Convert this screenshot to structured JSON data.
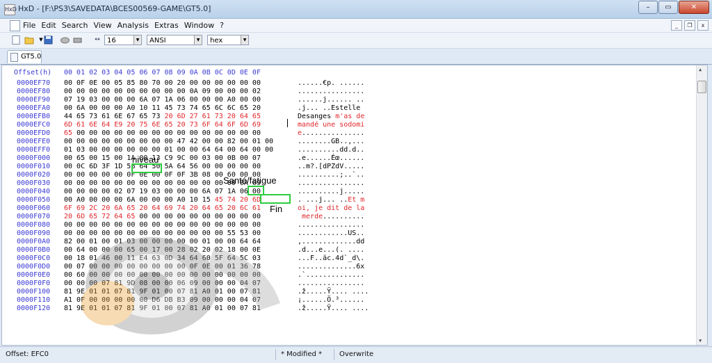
{
  "window": {
    "title": "HxD - [F:\\PS3\\SAVEDATA\\BCES00569-GAME\\GT5.0]",
    "app_icon": "HxD"
  },
  "window_buttons": [
    "–",
    "▭",
    "✕"
  ],
  "menu": [
    "File",
    "Edit",
    "Search",
    "View",
    "Analysis",
    "Extras",
    "Window",
    "?"
  ],
  "mdi_buttons": [
    "_",
    "❐",
    "x"
  ],
  "toolbar": {
    "bytes_per_row": "16",
    "charset": "ANSI",
    "display_mode": "hex"
  },
  "tab": {
    "label": "GT5.0"
  },
  "editor": {
    "offset_header": "Offset(h)",
    "column_header": "00 01 02 03 04 05 06 07 08 09 0A 0B 0C 0D 0E 0F",
    "rows": [
      {
        "offset": "0000EF70",
        "bytes": "00 0F 0E 00 05 85 80 70 00 20 00 00 00 00 00 00",
        "ascii": "......€p. ......"
      },
      {
        "offset": "0000EF80",
        "bytes": "00 00 00 00 00 00 00 00 00 00 0A 09 00 00 00 02",
        "ascii": "................"
      },
      {
        "offset": "0000EF90",
        "bytes": "07 19 03 00 00 00 6A 07 1A 06 00 00 00 A0 00 00",
        "ascii": "......j...... .."
      },
      {
        "offset": "0000EFA0",
        "bytes": "00 6A 00 00 00 A0 10 11 45 73 74 65 6C 6C 65 20",
        "ascii": ".j... ..Estelle "
      },
      {
        "offset": "0000EFB0",
        "bytes_black": "44 65 73 61 6E 67 65 73 ",
        "bytes_red": "20 6D 27 61 73 20 64 65",
        "ascii_black": "Desanges",
        "ascii_red": " m'as de"
      },
      {
        "offset": "0000EFC0",
        "bytes_red": "6D 61 6E 64 E9 20 75 6E 65 20 73 6F 64 6F 6D 69",
        "ascii_red": "mandé une sodomi"
      },
      {
        "offset": "0000EFD0",
        "bytes_red": "65",
        "bytes_black": " 00 00 00 00 00 00 00 00 00 00 00 00 00 00 00",
        "ascii_red": "e",
        "ascii_black": "..............."
      },
      {
        "offset": "0000EFE0",
        "bytes": "00 00 00 00 00 00 00 00 00 47 42 00 00 82 00 01 00",
        "ascii": "........GB..,..."
      },
      {
        "offset": "0000EFF0",
        "bytes": "01 03 00 00 00 00 00 00 01 00 00 64 64 00 64 00 00",
        "ascii": "..........dd.d.."
      },
      {
        "offset": "0000F000",
        "bytes": "00 65 00 15 00 1A 00 13 C9 9C 00 03 00 0B 00 07",
        "ascii": ".e......Éœ......"
      },
      {
        "offset": "0000F010",
        "bytes": "00 0C 6D 3F 1D 5B 64 50 5A 64 56 00 00 00 00 00",
        "ascii": "..m?.[dPZdV....."
      },
      {
        "offset": "0000F020",
        "bytes": "00 00 00 00 00 0F 0E 00 0F 0F 3B 08 00 60 00 00",
        "ascii": "..........;..`.."
      },
      {
        "offset": "0000F030",
        "bytes": "00 00 00 00 00 00 00 00 00 00 00 00 00 00 0A 09",
        "ascii": "................"
      },
      {
        "offset": "0000F040",
        "bytes": "00 00 00 00 02 07 19 03 00 00 00 6A 07 1A 06 00",
        "ascii": "..........j....."
      },
      {
        "offset": "0000F050",
        "bytes_black": "00 A0 00 00 00 6A 00 00 00 A0 10 15 ",
        "bytes_red": "45 74 20 6D",
        "ascii_black": ". ...j... ..",
        "ascii_red": "Et m"
      },
      {
        "offset": "0000F060",
        "bytes_red": "6F 69 2C 20 6A 65 20 64 69 74 20 64 65 20 6C 61",
        "ascii_red": "oi, je dit de la"
      },
      {
        "offset": "0000F070",
        "bytes_red": "20 6D 65 72 64 65",
        "bytes_black": " 00 00 00 00 00 00 00 00 00 00",
        "ascii_red": " merde",
        "ascii_black": ".........."
      },
      {
        "offset": "0000F080",
        "bytes": "00 00 00 00 00 00 00 00 00 00 00 00 00 00 00 00",
        "ascii": "................"
      },
      {
        "offset": "0000F090",
        "bytes": "00 00 00 00 00 00 00 00 00 00 00 00 00 55 53 00",
        "ascii": "............US.."
      },
      {
        "offset": "0000F0A0",
        "bytes": "82 00 01 00 01 03 00 00 00 00 00 01 00 00 64 64",
        "ascii": ",.............dd"
      },
      {
        "offset": "0000F0B0",
        "bytes": "00 64 00 00 00 65 00 17 00 28 02 20 02 18 00 0E",
        "ascii": ".d...e...(. ...."
      },
      {
        "offset": "0000F0C0",
        "bytes": "00 18 01 46 00 11 E4 63 0D 34 64 60 5F 64 5C 03",
        "ascii": "...F..äc.4d`_d\\."
      },
      {
        "offset": "0000F0D0",
        "bytes": "00 07 00 00 00 00 00 00 00 00 0F 0E 00 01 36 78",
        "ascii": "..............6x"
      },
      {
        "offset": "0000F0E0",
        "bytes": "00 60 00 00 00 00 00 00 00 00 00 00 00 00 00 00",
        "ascii": ".`.............."
      },
      {
        "offset": "0000F0F0",
        "bytes": "00 00 00 07 81 9D 08 00 00 06 09 00 00 00 04 07",
        "ascii": "................"
      },
      {
        "offset": "0000F100",
        "bytes": "81 9E 01 01 07 81 9F 01 00 07 81 A0 01 00 07 81",
        "ascii": ".ž.....Ÿ.... ...."
      },
      {
        "offset": "0000F110",
        "bytes": "A1 0F 00 00 00 00 00 D6 DB B3 09 00 00 00 04 07",
        "ascii": "¡......Ö.³......"
      },
      {
        "offset": "0000F120",
        "bytes": "81 9E 01 01 07 81 9F 01 00 07 81 A0 01 00 07 81",
        "ascii": ".ž.....Ÿ.... ...."
      }
    ]
  },
  "annotations": {
    "niveau": "niveau",
    "sante": "Santé/fatigue",
    "fin": "Fin"
  },
  "status": {
    "offset": "Offset: EFC0",
    "modified": "* Modified *",
    "mode": "Overwrite"
  }
}
